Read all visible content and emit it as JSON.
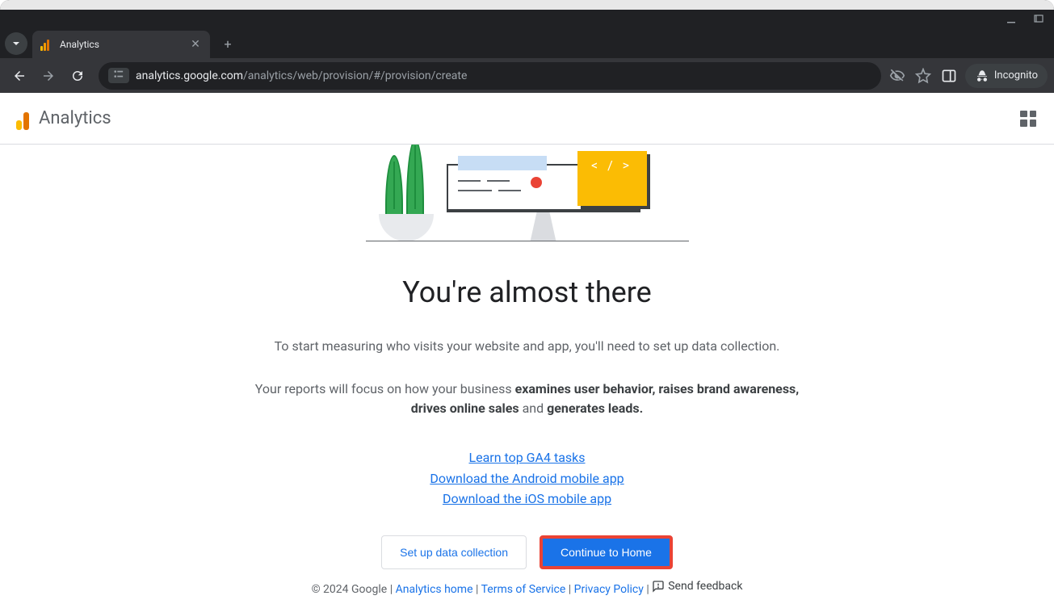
{
  "browser": {
    "tab_title": "Analytics",
    "url_domain": "analytics.google.com",
    "url_path": "/analytics/web/provision/#/provision/create",
    "incognito_label": "Incognito"
  },
  "header": {
    "app_name": "Analytics"
  },
  "main": {
    "headline": "You're almost there",
    "subtext": "To start measuring who visits your website and app, you'll need to set up data collection.",
    "para2_prefix": "Your reports will focus on how your business ",
    "para2_bold1": "examines user behavior, raises brand awareness, drives online sales",
    "para2_mid": " and ",
    "para2_bold2": "generates leads.",
    "links": {
      "ga4_tasks": "Learn top GA4 tasks",
      "android_app": "Download the Android mobile app",
      "ios_app": "Download the iOS mobile app"
    },
    "buttons": {
      "setup": "Set up data collection",
      "continue": "Continue to Home"
    }
  },
  "footer": {
    "copyright": "© 2024 Google",
    "analytics_home": "Analytics home",
    "tos": "Terms of Service",
    "privacy": "Privacy Policy",
    "feedback": "Send feedback"
  }
}
